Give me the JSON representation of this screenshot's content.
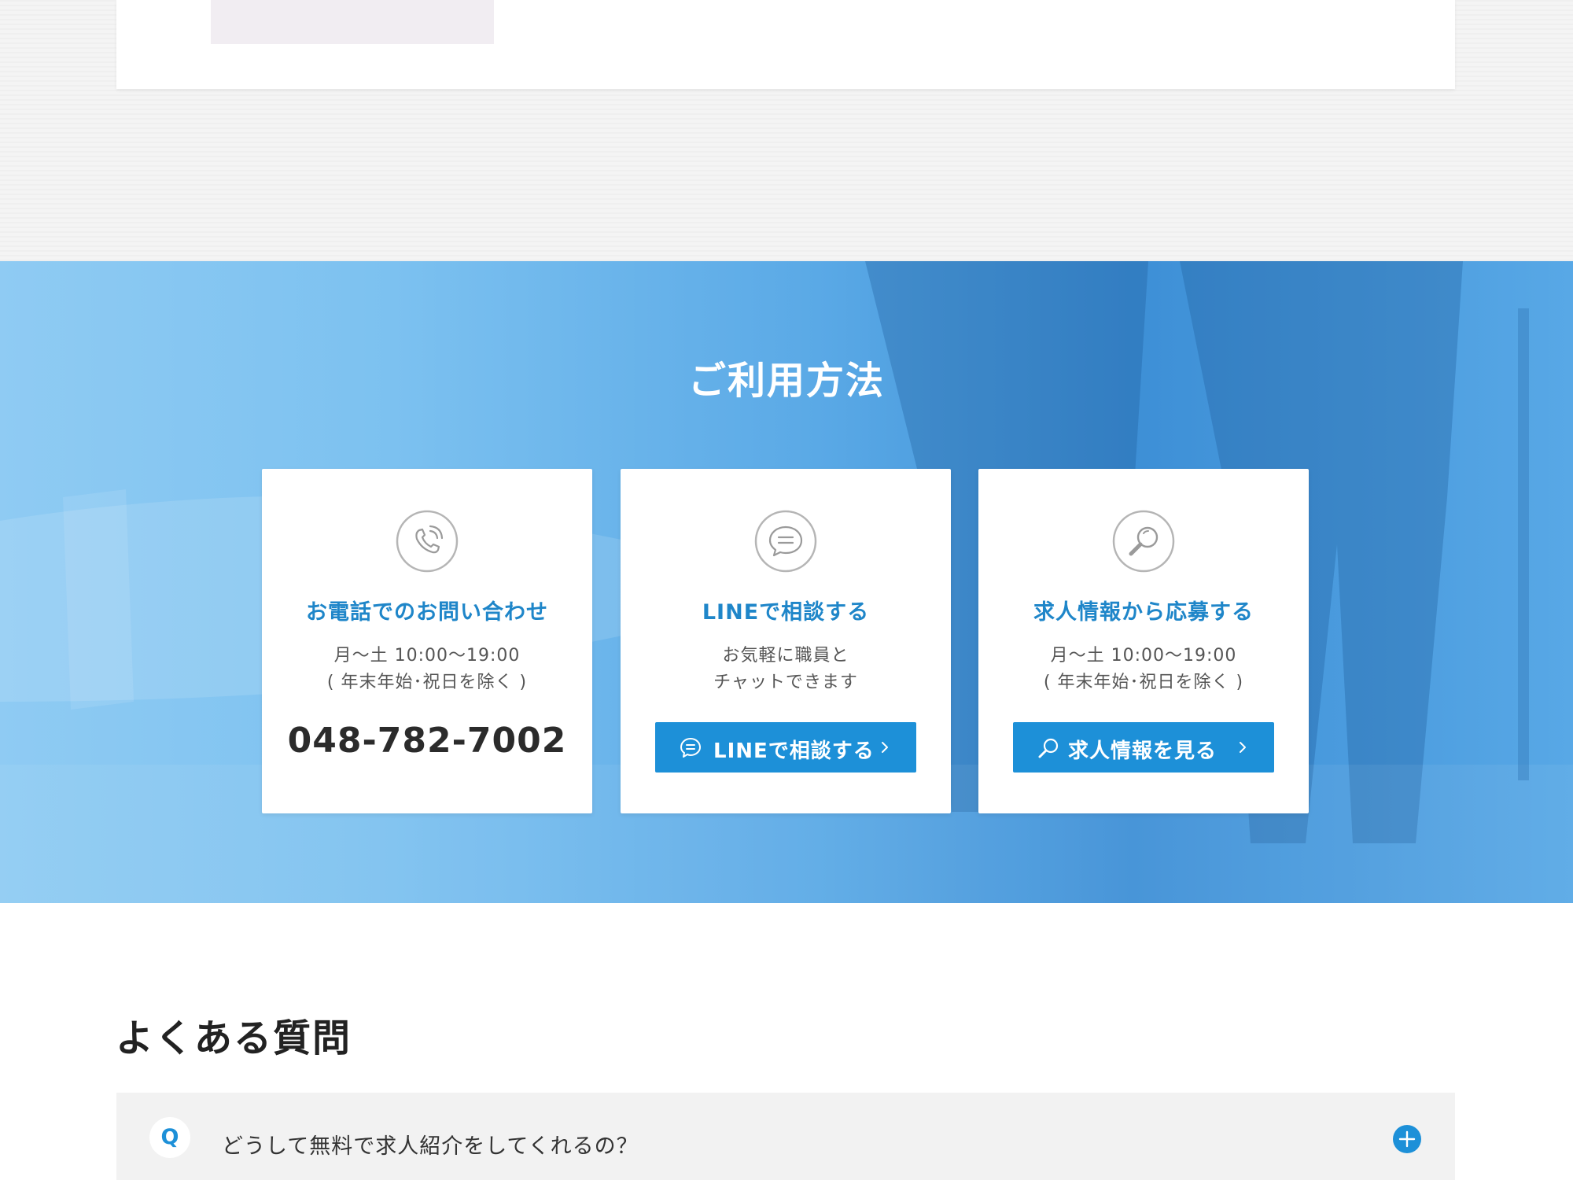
{
  "usage": {
    "title": "ご利用方法",
    "cards": [
      {
        "icon": "phone-icon",
        "title": "お電話でのお問い合わせ",
        "line1": "月〜土 10:00〜19:00",
        "line2": "( 年末年始･祝日を除く )",
        "phone": "048-782-7002"
      },
      {
        "icon": "chat-icon",
        "title": "LINEで相談する",
        "line1": "お気軽に職員と",
        "line2": "チャットできます",
        "button": {
          "label": "LINEで相談する",
          "icon": "chat-icon"
        }
      },
      {
        "icon": "search-icon",
        "title": "求人情報から応募する",
        "line1": "月〜土 10:00〜19:00",
        "line2": "( 年末年始･祝日を除く )",
        "button": {
          "label": "求人情報を見る",
          "icon": "search-icon"
        }
      }
    ]
  },
  "faq": {
    "title": "よくある質問",
    "items": [
      {
        "badge": "Q",
        "question": "どうして無料で求人紹介をしてくれるの？",
        "toggle_icon": "plus-icon"
      }
    ]
  },
  "colors": {
    "accent": "#1d90d8",
    "card_title": "#1f86c9",
    "icon_gray": "#b5b5b5"
  }
}
